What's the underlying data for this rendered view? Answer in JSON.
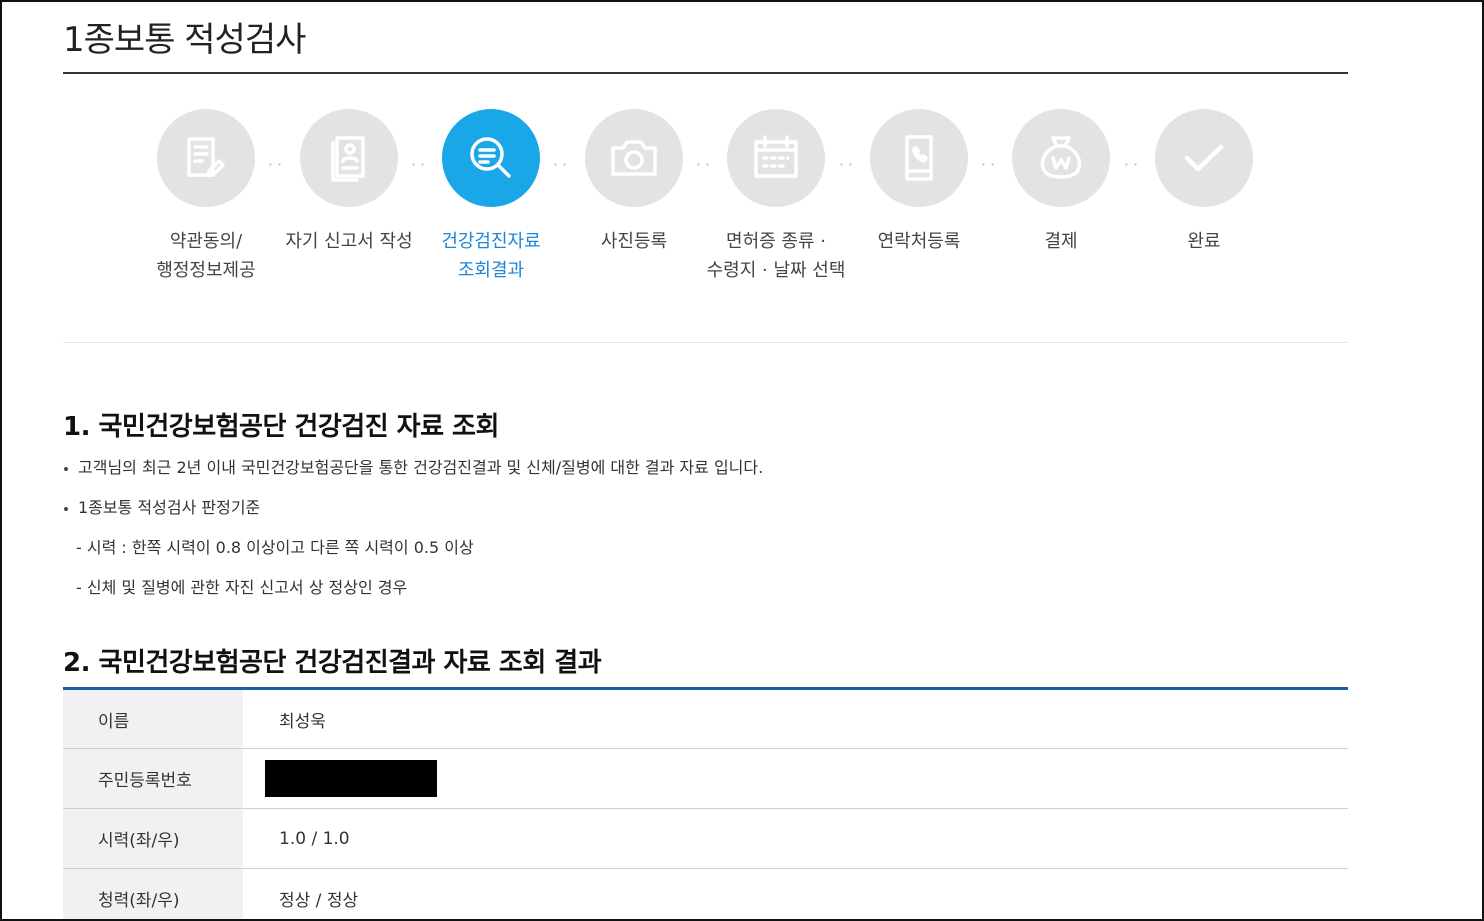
{
  "page_title": "1종보통 적성검사",
  "steps": [
    {
      "line1": "약관동의/",
      "line2": "행정정보제공",
      "icon": "document-pen-icon",
      "active": false
    },
    {
      "line1": "자기 신고서 작성",
      "line2": "",
      "icon": "user-file-icon",
      "active": false
    },
    {
      "line1": "건강검진자료",
      "line2": "조회결과",
      "icon": "search-document-icon",
      "active": true
    },
    {
      "line1": "사진등록",
      "line2": "",
      "icon": "camera-icon",
      "active": false
    },
    {
      "line1": "면허증 종류 ·",
      "line2": "수령지 · 날짜 선택",
      "icon": "calendar-icon",
      "active": false
    },
    {
      "line1": "연락처등록",
      "line2": "",
      "icon": "phone-icon",
      "active": false
    },
    {
      "line1": "결제",
      "line2": "",
      "icon": "money-bag-icon",
      "active": false
    },
    {
      "line1": "완료",
      "line2": "",
      "icon": "check-icon",
      "active": false
    }
  ],
  "colors": {
    "active": "#1aa7e8",
    "inactive": "#e3e3e3",
    "table_top_border": "#1a5fa8"
  },
  "section1": {
    "title": "1. 국민건강보험공단 건강검진 자료 조회",
    "lines": [
      "고객님의 최근 2년 이내 국민건강보험공단을 통한 건강검진결과 및 신체/질병에 대한 결과 자료 입니다.",
      "1종보통 적성검사 판정기준",
      "- 시력 : 한쪽 시력이 0.8 이상이고 다른 쪽 시력이 0.5 이상",
      "- 신체 및 질병에 관한 자진 신고서 상 정상인 경우"
    ]
  },
  "section2": {
    "title": "2. 국민건강보험공단 건강검진결과 자료 조회 결과",
    "rows": [
      {
        "label": "이름",
        "value": "최성욱"
      },
      {
        "label": "주민등록번호",
        "value": ""
      },
      {
        "label": "시력(좌/우)",
        "value": "1.0 / 1.0"
      },
      {
        "label": "청력(좌/우)",
        "value": "정상 / 정상"
      }
    ]
  }
}
